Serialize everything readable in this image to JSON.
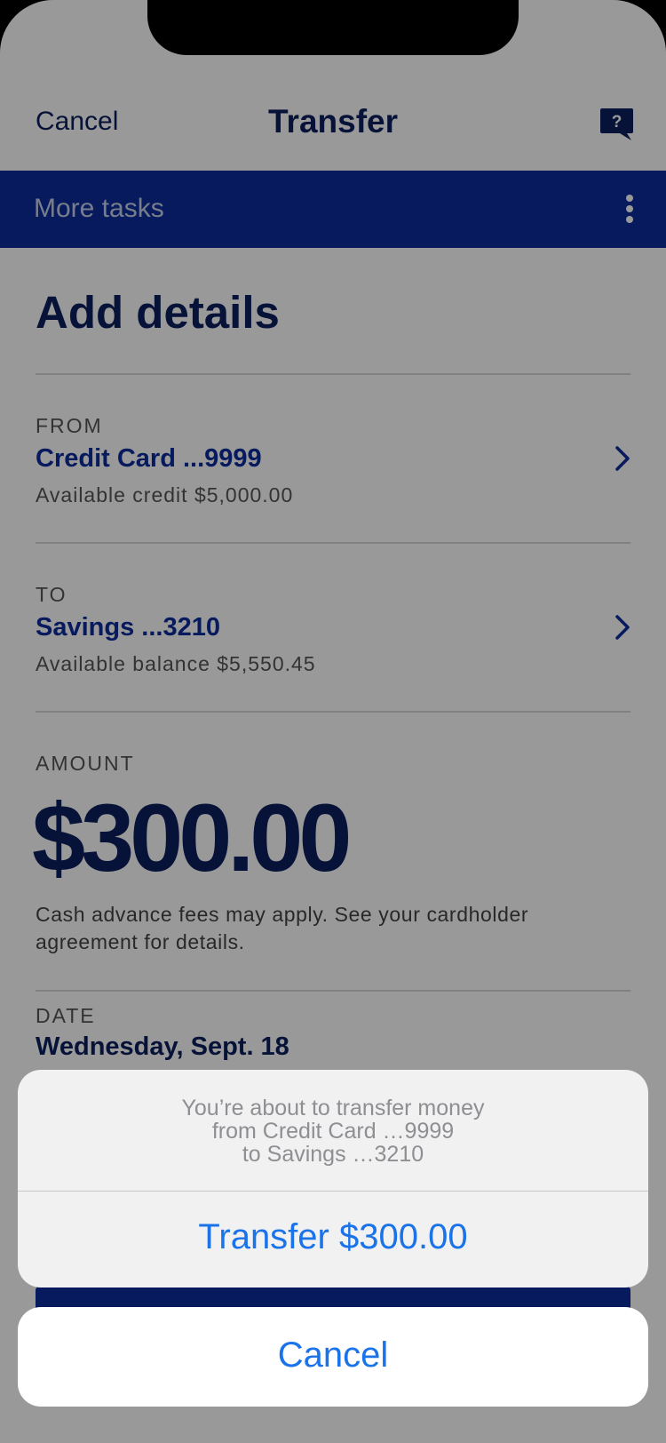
{
  "header": {
    "cancel_label": "Cancel",
    "title": "Transfer",
    "help_icon": "help-question-icon",
    "help_glyph": "?"
  },
  "tasks_bar": {
    "label": "More tasks",
    "menu_icon": "kebab-menu-icon"
  },
  "page": {
    "heading": "Add details"
  },
  "from": {
    "label": "FROM",
    "account": "Credit Card ...9999",
    "detail": "Available credit $5,000.00"
  },
  "to": {
    "label": "TO",
    "account": "Savings ...3210",
    "detail": "Available balance $5,550.45"
  },
  "amount": {
    "label": "AMOUNT",
    "value": "$300.00",
    "note": "Cash advance fees may apply. See your cardholder agreement for details."
  },
  "date": {
    "label": "DATE",
    "value": "Wednesday, Sept. 18"
  },
  "action_sheet": {
    "message_lines": [
      "You’re about to transfer money",
      "from Credit Card …9999",
      "to Savings …3210"
    ],
    "confirm_label": "Transfer $300.00",
    "cancel_label": "Cancel"
  },
  "colors": {
    "brand_navy": "#0a1f5c",
    "brand_blue": "#0a2c9c",
    "ios_action_blue": "#1a73e8"
  }
}
